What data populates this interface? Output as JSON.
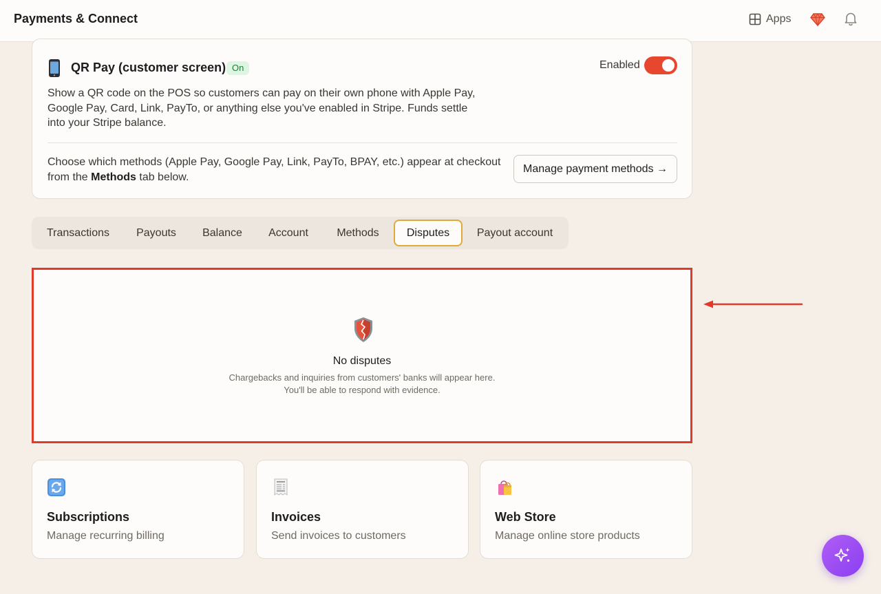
{
  "header": {
    "title": "Payments & Connect",
    "apps_label": "Apps"
  },
  "qr_pay": {
    "title": "QR Pay (customer screen)",
    "status_badge": "On",
    "toggle_label": "Enabled",
    "toggle_on": true,
    "description": "Show a QR code on the POS so customers can pay on their own phone with Apple Pay, Google Pay, Card, Link, PayTo, or anything else you've enabled in Stripe. Funds settle into your Stripe balance.",
    "methods_note_prefix": "Choose which methods (Apple Pay, Google Pay, Link, PayTo, BPAY, etc.) appear at checkout from the ",
    "methods_note_bold": "Methods",
    "methods_note_suffix": " tab below.",
    "manage_button": "Manage payment methods →"
  },
  "tabs": [
    {
      "label": "Transactions"
    },
    {
      "label": "Payouts"
    },
    {
      "label": "Balance"
    },
    {
      "label": "Account"
    },
    {
      "label": "Methods"
    },
    {
      "label": "Disputes",
      "active": true
    },
    {
      "label": "Payout account"
    }
  ],
  "disputes": {
    "icon": "shield-icon",
    "title": "No disputes",
    "line1": "Chargebacks and inquiries from customers' banks will appear here.",
    "line2": "You'll be able to respond with evidence."
  },
  "cards": [
    {
      "icon": "refresh-icon",
      "title": "Subscriptions",
      "description": "Manage recurring billing"
    },
    {
      "icon": "receipt-icon",
      "title": "Invoices",
      "description": "Send invoices to customers"
    },
    {
      "icon": "shopping-bags-icon",
      "title": "Web Store",
      "description": "Manage online store products"
    }
  ],
  "colors": {
    "accent_red": "#e7472e",
    "highlight_border": "#e23a2a",
    "active_tab_border": "#e0a93a",
    "badge_green_bg": "#dff5e3",
    "fab_purple": "#9b4ff2",
    "page_bg": "#f6efe8"
  }
}
